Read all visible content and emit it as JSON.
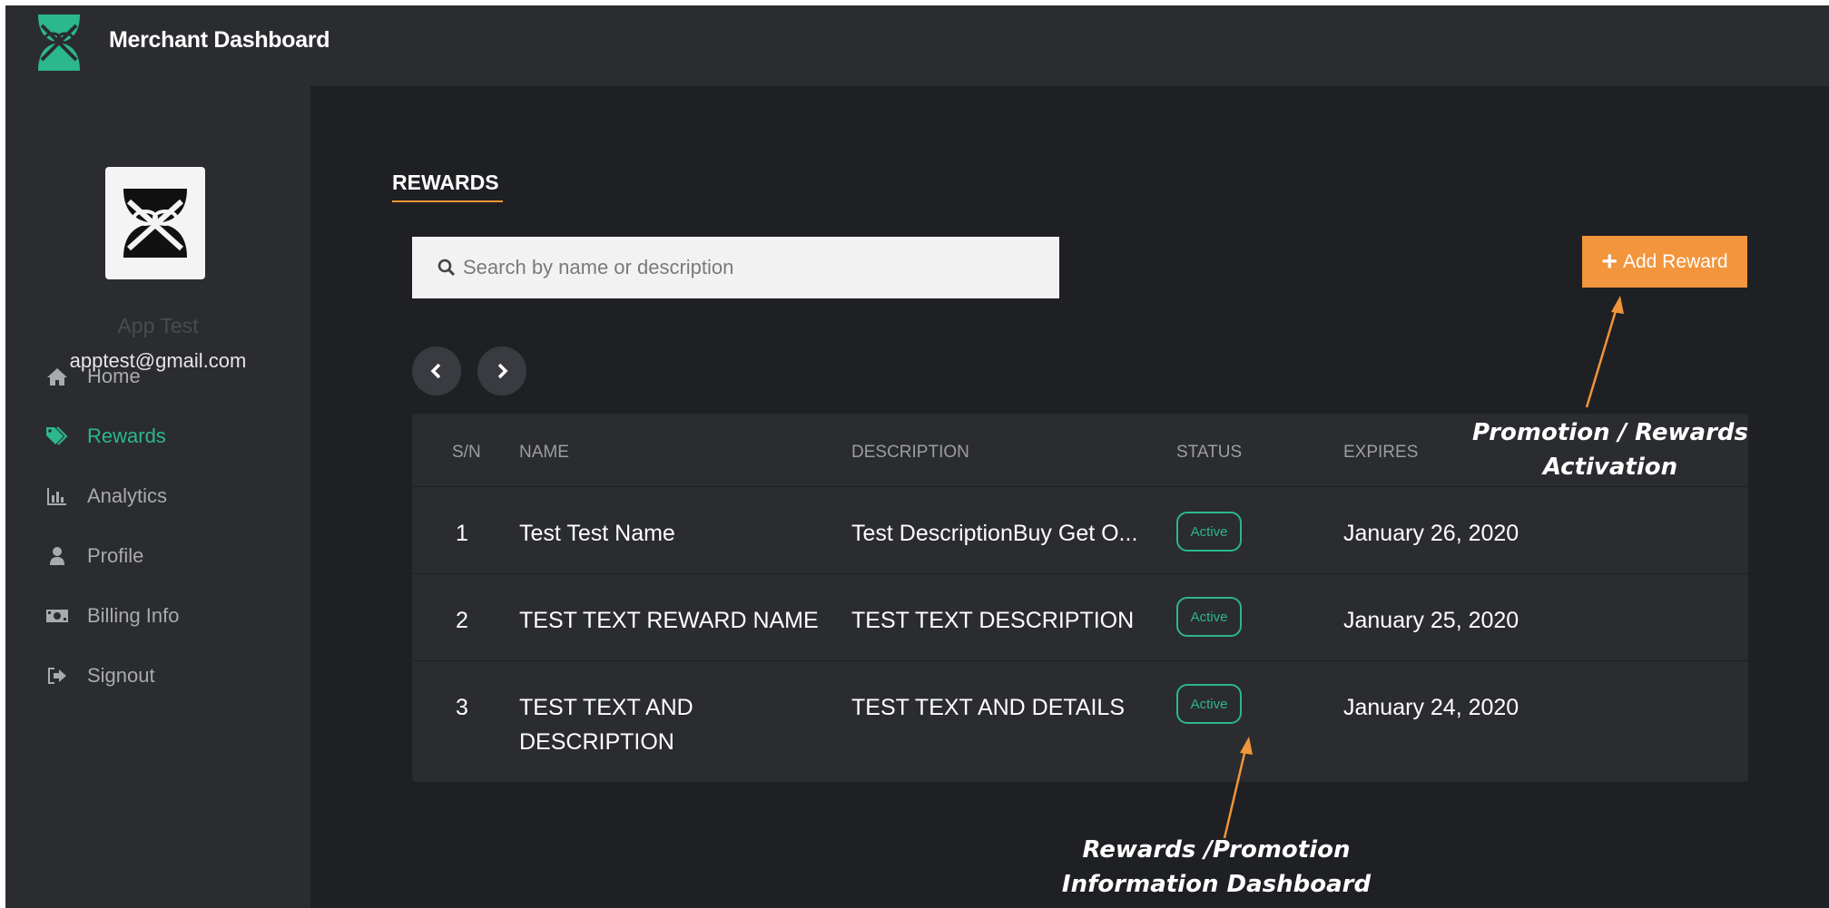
{
  "header": {
    "title": "Merchant Dashboard"
  },
  "user": {
    "name": "App Test",
    "email": "apptest@gmail.com"
  },
  "sidebar": {
    "items": [
      {
        "label": "Home",
        "icon": "home-icon"
      },
      {
        "label": "Rewards",
        "icon": "tag-icon",
        "active": true
      },
      {
        "label": "Analytics",
        "icon": "bar-chart-icon"
      },
      {
        "label": "Profile",
        "icon": "user-icon"
      },
      {
        "label": "Billing Info",
        "icon": "money-icon"
      },
      {
        "label": "Signout",
        "icon": "signout-icon"
      }
    ]
  },
  "main": {
    "section_title": "REWARDS",
    "search": {
      "placeholder": "Search by name or description",
      "value": ""
    },
    "add_button_label": "Add Reward",
    "table": {
      "columns": [
        "S/N",
        "NAME",
        "DESCRIPTION",
        "STATUS",
        "EXPIRES"
      ],
      "rows": [
        {
          "sn": "1",
          "name": "Test Test Name",
          "name2": "",
          "description": "Test DescriptionBuy Get O...",
          "status": "Active",
          "expires": "January 26, 2020"
        },
        {
          "sn": "2",
          "name": "TEST TEXT REWARD NAME",
          "name2": "",
          "description": "TEST TEXT DESCRIPTION",
          "status": "Active",
          "expires": "January 25, 2020"
        },
        {
          "sn": "3",
          "name": "TEST TEXT AND",
          "name2": "DESCRIPTION",
          "description": "TEST TEXT AND DETAILS",
          "status": "Active",
          "expires": "January 24, 2020"
        }
      ]
    }
  },
  "annotations": {
    "activation": {
      "line1": "Promotion / Rewards",
      "line2": "Activation"
    },
    "dashboard": {
      "line1": "Rewards /Promotion",
      "line2": "Information  Dashboard"
    }
  },
  "colors": {
    "accent": "#f2953c",
    "active": "#2bb88a",
    "background": "#1f2024",
    "panel": "#2b2c30"
  }
}
